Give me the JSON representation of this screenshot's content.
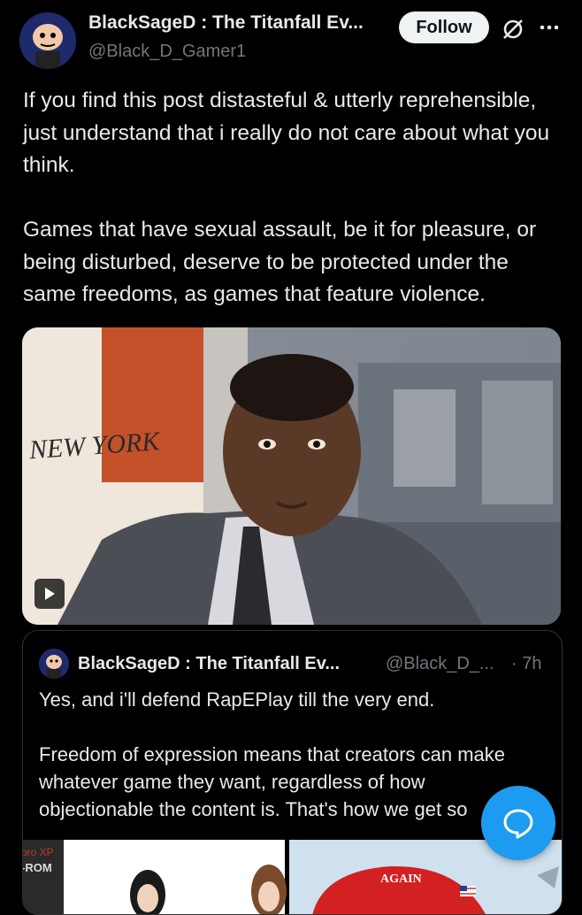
{
  "author": {
    "name": "BlackSageD : The Titanfall Ev...",
    "handle": "@Black_D_Gamer1",
    "follow_label": "Follow"
  },
  "post": {
    "text": "If you find this post distasteful & utterly reprehensible, just understand that i really do not care about what you think.\n\nGames that have sexual assault, be it for pleasure, or being disturbed, deserve to be protected under the same freedoms, as games that feature violence.",
    "media": {
      "overlay_text": "NEW YORK",
      "type": "video"
    }
  },
  "quoted_post": {
    "name": "BlackSageD : The Titanfall Ev...",
    "handle": "@Black_D_...",
    "time": "· 7h",
    "text": "Yes, and i'll defend RapEPlay till the very end.\n\nFreedom of expression means that creators can make whatever game they want, regardless of how objectionable the content is. That's how we get so",
    "image_texts": [
      "pro XP",
      "-ROM",
      "AGAIN"
    ]
  },
  "icons": {
    "grok": "grok-icon",
    "more": "more-dots-icon",
    "play": "play-icon",
    "reply_fab": "chat-bubble-icon"
  },
  "colors": {
    "background": "#000000",
    "text": "#e7e9ea",
    "secondary": "#71767b",
    "accent": "#1d9bf0"
  }
}
